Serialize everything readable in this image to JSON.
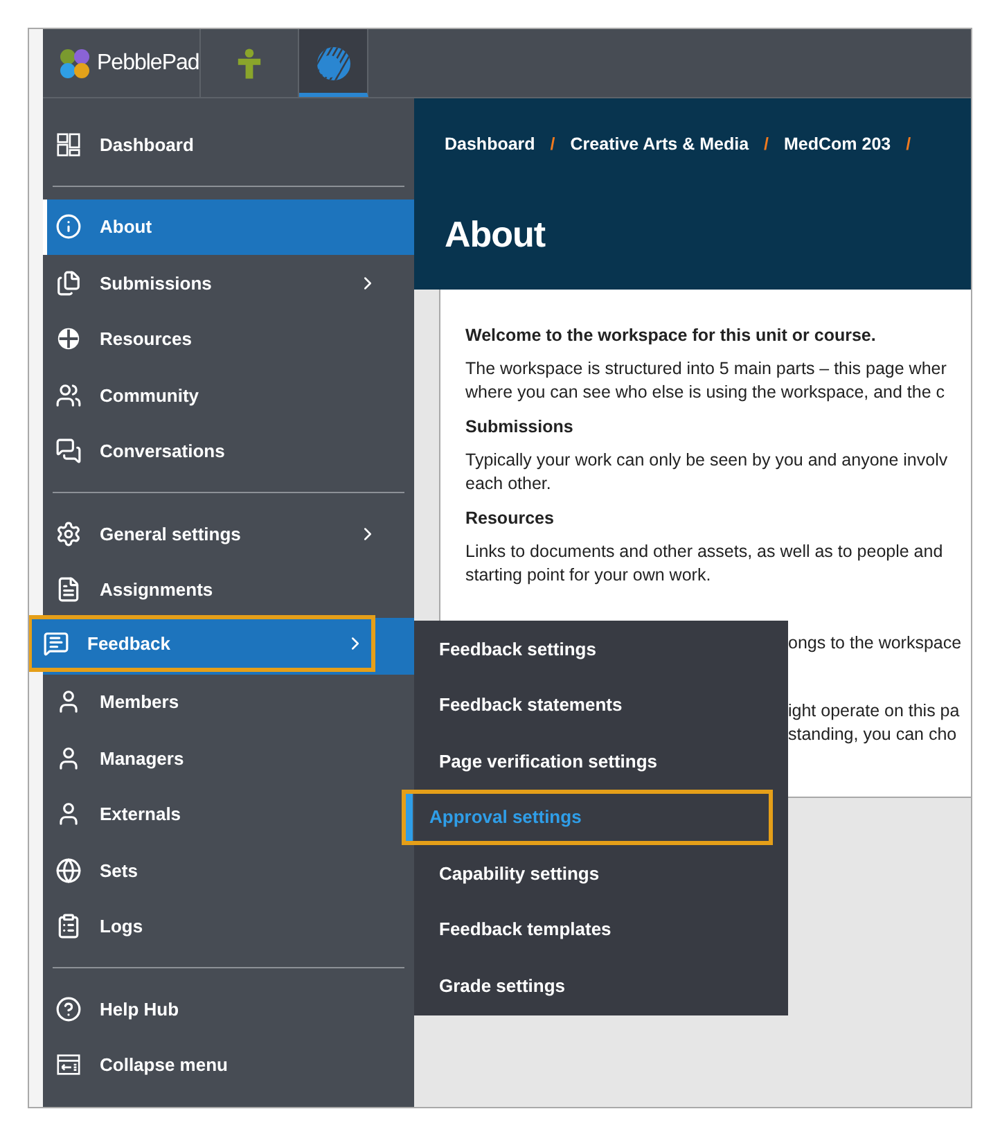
{
  "top_bar": {
    "logo_text": "PebblePad",
    "tabs": [
      {
        "kind": "person",
        "selected": false
      },
      {
        "kind": "globe",
        "selected": true
      }
    ]
  },
  "sidebar": {
    "sections": [
      {
        "items": [
          {
            "label": "Dashboard",
            "selected": false,
            "expanded": false,
            "has_submenu": false,
            "highlighted": false
          }
        ]
      },
      {
        "items": [
          {
            "label": "About",
            "selected": true,
            "expanded": false,
            "has_submenu": false,
            "highlighted": false
          },
          {
            "label": "Submissions",
            "selected": false,
            "expanded": false,
            "has_submenu": true,
            "highlighted": false
          },
          {
            "label": "Resources",
            "selected": false,
            "expanded": false,
            "has_submenu": false,
            "highlighted": false
          },
          {
            "label": "Community",
            "selected": false,
            "expanded": false,
            "has_submenu": false,
            "highlighted": false
          },
          {
            "label": "Conversations",
            "selected": false,
            "expanded": false,
            "has_submenu": false,
            "highlighted": false
          }
        ]
      },
      {
        "items": [
          {
            "label": "General settings",
            "selected": false,
            "expanded": false,
            "has_submenu": true,
            "highlighted": false
          },
          {
            "label": "Assignments",
            "selected": false,
            "expanded": false,
            "has_submenu": false,
            "highlighted": false
          },
          {
            "label": "Feedback",
            "selected": false,
            "expanded": true,
            "has_submenu": true,
            "highlighted": true,
            "submenu": [
              {
                "label": "Feedback settings",
                "selected": false,
                "highlighted": false
              },
              {
                "label": "Feedback statements",
                "selected": false,
                "highlighted": false
              },
              {
                "label": "Page verification settings",
                "selected": false,
                "highlighted": false
              },
              {
                "label": "Approval settings",
                "selected": true,
                "highlighted": true
              },
              {
                "label": "Capability settings",
                "selected": false,
                "highlighted": false
              },
              {
                "label": "Feedback templates",
                "selected": false,
                "highlighted": false
              },
              {
                "label": "Grade settings",
                "selected": false,
                "highlighted": false
              }
            ]
          },
          {
            "label": "Members",
            "selected": false,
            "expanded": false,
            "has_submenu": false,
            "highlighted": false
          },
          {
            "label": "Managers",
            "selected": false,
            "expanded": false,
            "has_submenu": false,
            "highlighted": false
          },
          {
            "label": "Externals",
            "selected": false,
            "expanded": false,
            "has_submenu": false,
            "highlighted": false
          },
          {
            "label": "Sets",
            "selected": false,
            "expanded": false,
            "has_submenu": false,
            "highlighted": false
          },
          {
            "label": "Logs",
            "selected": false,
            "expanded": false,
            "has_submenu": false,
            "highlighted": false
          }
        ]
      },
      {
        "items": [
          {
            "label": "Help Hub",
            "selected": false,
            "expanded": false,
            "has_submenu": false,
            "highlighted": false
          },
          {
            "label": "Collapse menu",
            "selected": false,
            "expanded": false,
            "has_submenu": false,
            "highlighted": false
          }
        ]
      }
    ]
  },
  "header": {
    "breadcrumbs": [
      {
        "label": "Dashboard",
        "separator": "/"
      },
      {
        "label": "Creative Arts & Media",
        "separator": "/"
      },
      {
        "label": "MedCom 203",
        "separator": "/"
      }
    ],
    "title": "About"
  },
  "content": {
    "blocks": [
      {
        "kind": "heading",
        "lines": [
          "Welcome to the workspace for this unit or course."
        ]
      },
      {
        "kind": "paragraph",
        "lines": [
          "The workspace is structured into 5 main parts – this page wher",
          "where you can see who else is using the workspace, and the c"
        ]
      },
      {
        "kind": "heading",
        "lines": [
          "Submissions"
        ]
      },
      {
        "kind": "paragraph",
        "lines": [
          "Typically your work can only be seen by you and anyone involv",
          "each other."
        ]
      },
      {
        "kind": "heading",
        "lines": [
          "Resources"
        ]
      },
      {
        "kind": "paragraph",
        "lines": [
          "Links to documents and other assets, as well as to people and",
          "starting point for your own work."
        ]
      },
      {
        "kind": "covered_paragraph",
        "lines": [
          "ongs to the workspace"
        ]
      },
      {
        "kind": "covered_paragraph",
        "lines": [
          "ight operate on this pa",
          "standing, you can cho"
        ]
      }
    ]
  }
}
